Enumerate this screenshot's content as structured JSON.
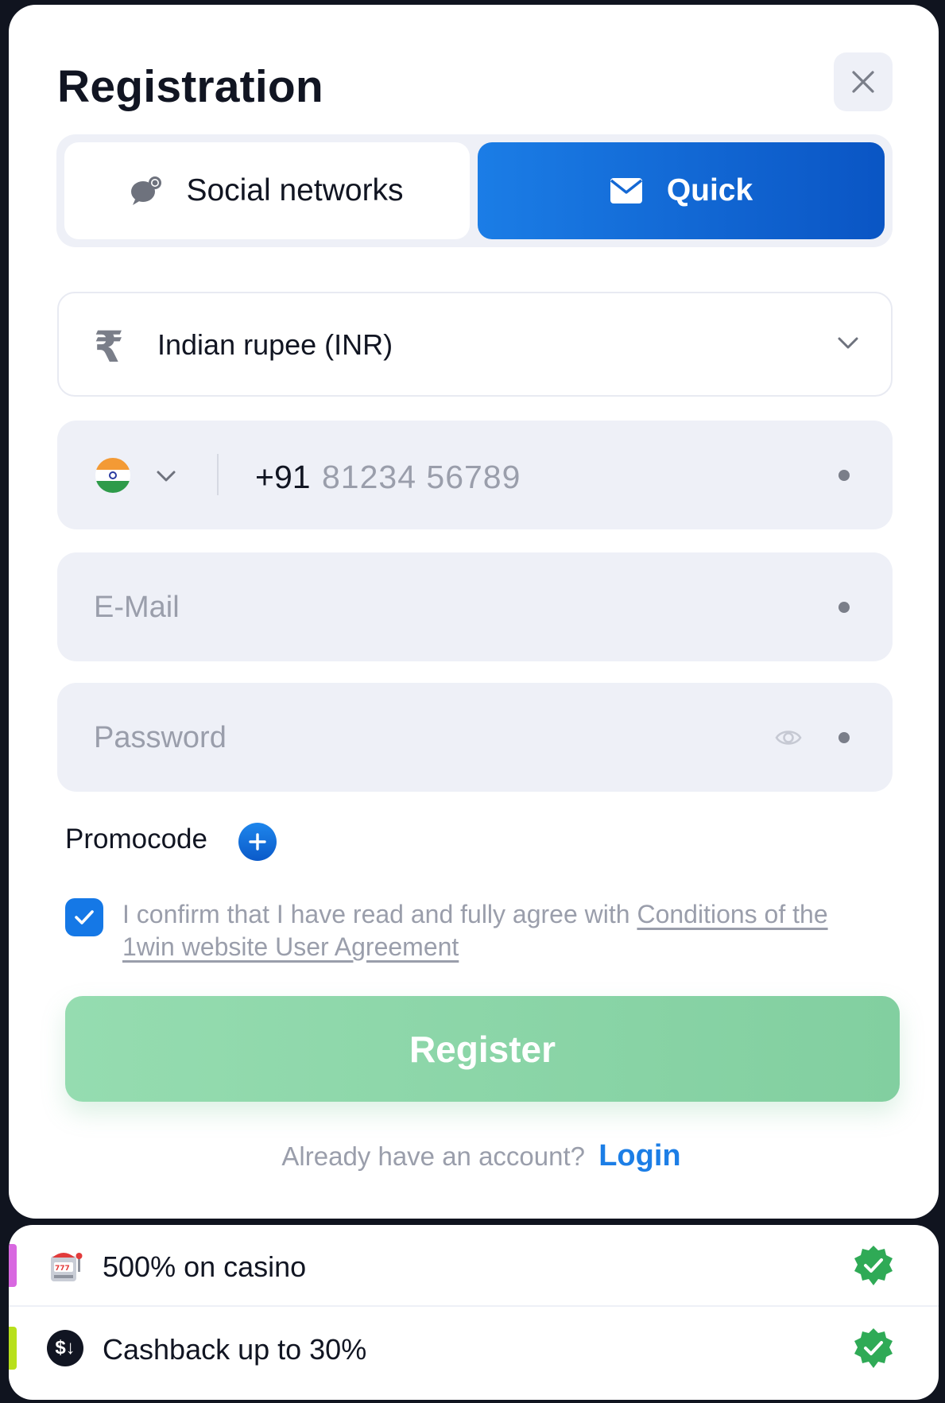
{
  "modal": {
    "title": "Registration"
  },
  "tabs": [
    {
      "label": "Social networks",
      "icon": "chat-bubble-icon",
      "active": false
    },
    {
      "label": "Quick",
      "icon": "envelope-icon",
      "active": true
    }
  ],
  "currency": {
    "symbol": "₹",
    "selected": "Indian rupee (INR)"
  },
  "phone": {
    "country_flag": "india-flag-icon",
    "code": "+91",
    "placeholder": "81234 56789"
  },
  "email": {
    "placeholder": "E-Mail"
  },
  "password": {
    "placeholder": "Password"
  },
  "promocode": {
    "label": "Promocode"
  },
  "agreement": {
    "text": "I confirm that I have read and fully agree with ",
    "link": "Conditions of the 1win website User Agreement",
    "checked": true
  },
  "register": {
    "label": "Register"
  },
  "login": {
    "prompt": "Already have an account?",
    "link": "Login"
  },
  "bonuses": [
    {
      "label": "500% on casino",
      "icon": "slot-machine-icon",
      "accent": "#d868e0"
    },
    {
      "label": "Cashback up to 30%",
      "icon": "dollar-cashback-icon",
      "badge_text": "$↓",
      "accent": "#b8e01c"
    }
  ],
  "colors": {
    "primary": "#1578e6",
    "register_bg": "#8fd8ab",
    "badge_green": "#2faa56"
  }
}
